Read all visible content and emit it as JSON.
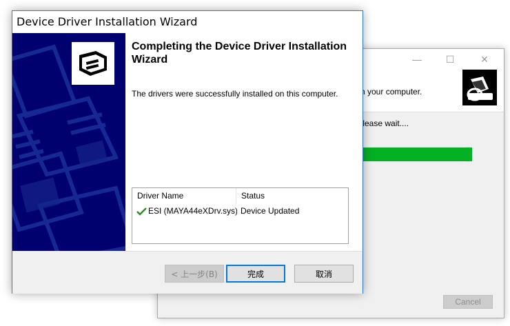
{
  "background_window": {
    "header_text": "r on your computer.",
    "status_text": "e. Please wait....",
    "progress_fraction": 1.0,
    "cancel_label": "Cancel",
    "controls": {
      "minimize": "—",
      "maximize": "☐",
      "close": "✕"
    }
  },
  "wizard": {
    "title": "Device Driver Installation Wizard",
    "heading": "Completing the Device Driver Installation Wizard",
    "message": "The drivers were successfully installed on this computer.",
    "table": {
      "columns": [
        "Driver Name",
        "Status"
      ],
      "rows": [
        {
          "name": "ESI (MAYA44eXDrv.sys)...",
          "status": "Device Updated"
        }
      ]
    },
    "buttons": {
      "back": "< 上一步(B)",
      "finish": "完成",
      "cancel": "取消"
    }
  },
  "colors": {
    "banner": "#00006e",
    "progress": "#06b025",
    "focus_border": "#0078d7",
    "check": "#2a8a2a"
  }
}
